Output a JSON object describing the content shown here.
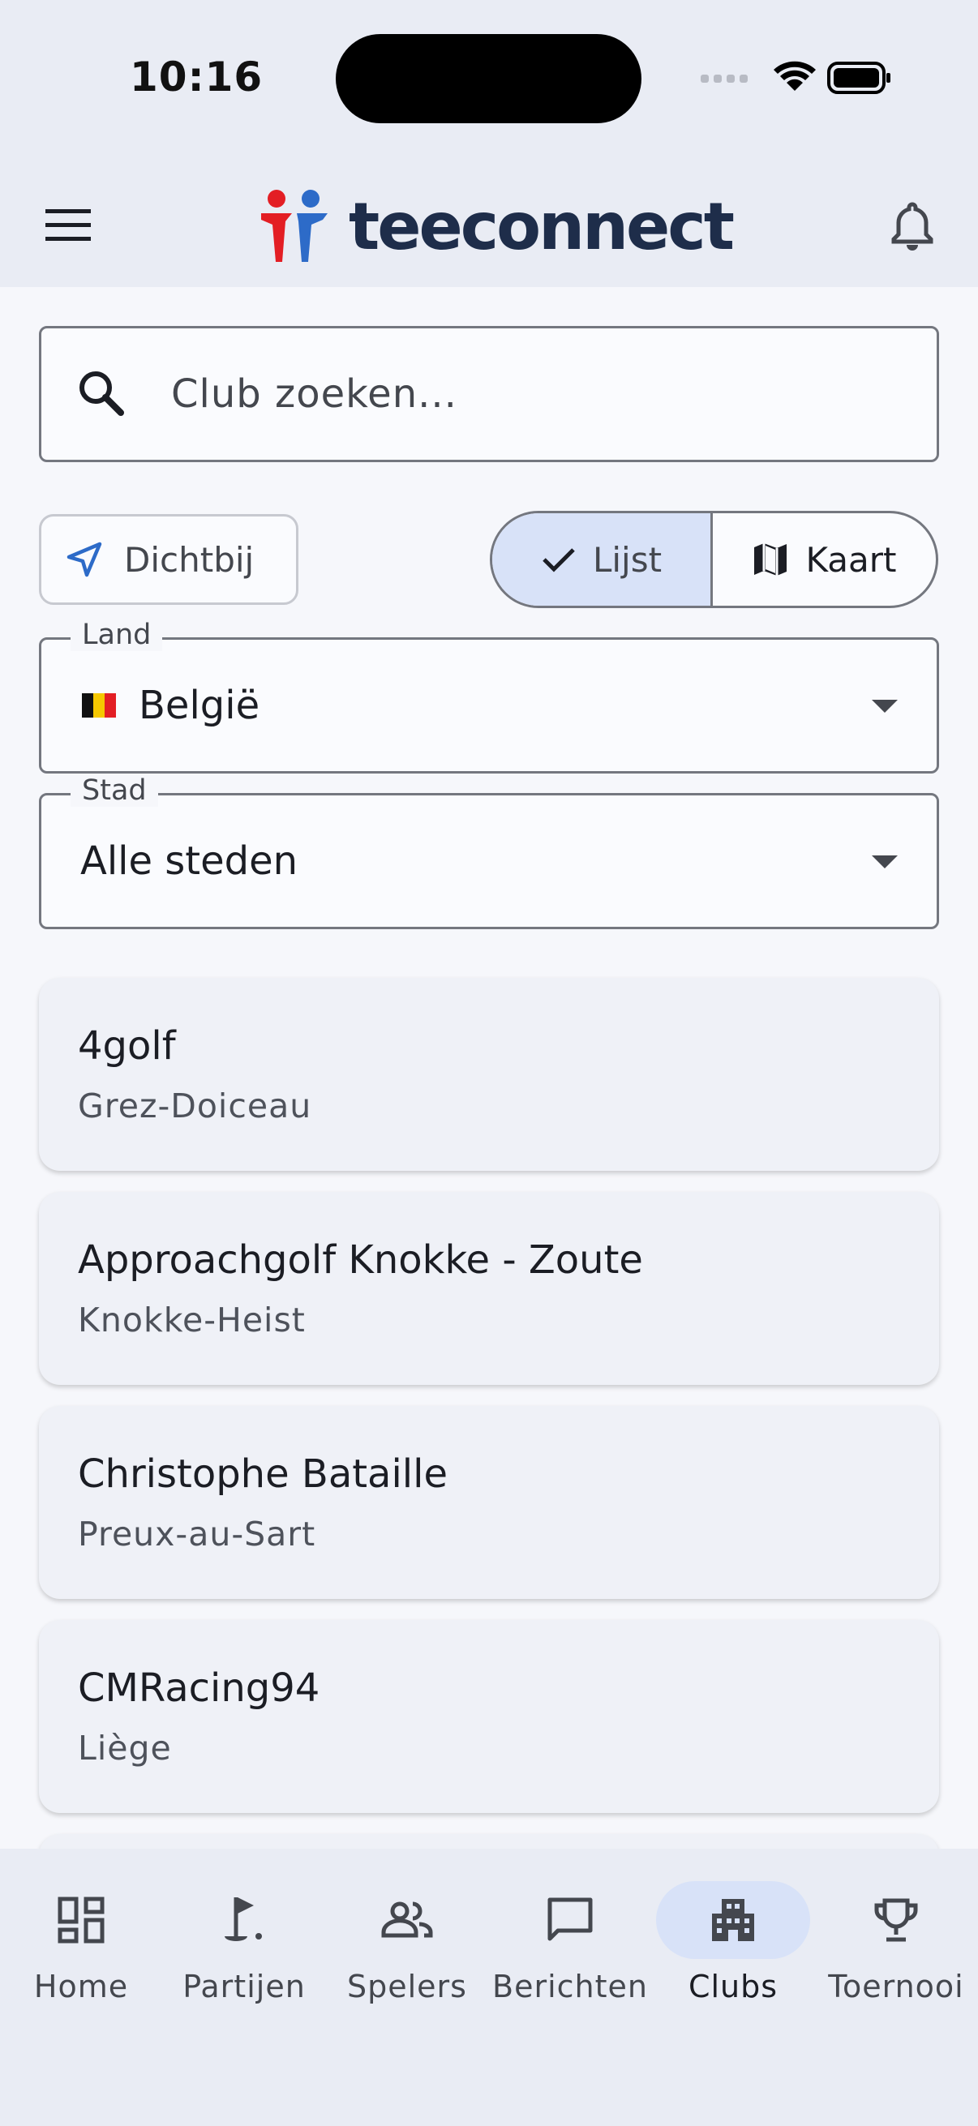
{
  "status_bar": {
    "time": "10:16"
  },
  "header": {
    "logo_text": "teeconnect",
    "brand_colors": {
      "red": "#E31E24",
      "blue": "#2D6BC8",
      "navy": "#1E2D4A"
    }
  },
  "search": {
    "placeholder": "Club zoeken..."
  },
  "filters": {
    "nearby_label": "Dichtbij",
    "view_toggle": {
      "list_label": "Lijst",
      "map_label": "Kaart",
      "selected": "Lijst"
    },
    "country": {
      "label": "Land",
      "value": "België"
    },
    "city": {
      "label": "Stad",
      "value": "Alle steden"
    }
  },
  "clubs": [
    {
      "name": "4golf",
      "city": "Grez-Doiceau"
    },
    {
      "name": "Approachgolf Knokke - Zoute",
      "city": "Knokke-Heist"
    },
    {
      "name": "Christophe Bataille",
      "city": "Preux-au-Sart"
    },
    {
      "name": "CMRacing94",
      "city": "Liège"
    }
  ],
  "bottom_nav": [
    {
      "label": "Home",
      "icon": "dashboard-icon"
    },
    {
      "label": "Partijen",
      "icon": "golf-flag-icon"
    },
    {
      "label": "Spelers",
      "icon": "people-icon"
    },
    {
      "label": "Berichten",
      "icon": "chat-icon"
    },
    {
      "label": "Clubs",
      "icon": "building-icon",
      "active": true
    },
    {
      "label": "Toernooi",
      "icon": "trophy-icon"
    }
  ]
}
